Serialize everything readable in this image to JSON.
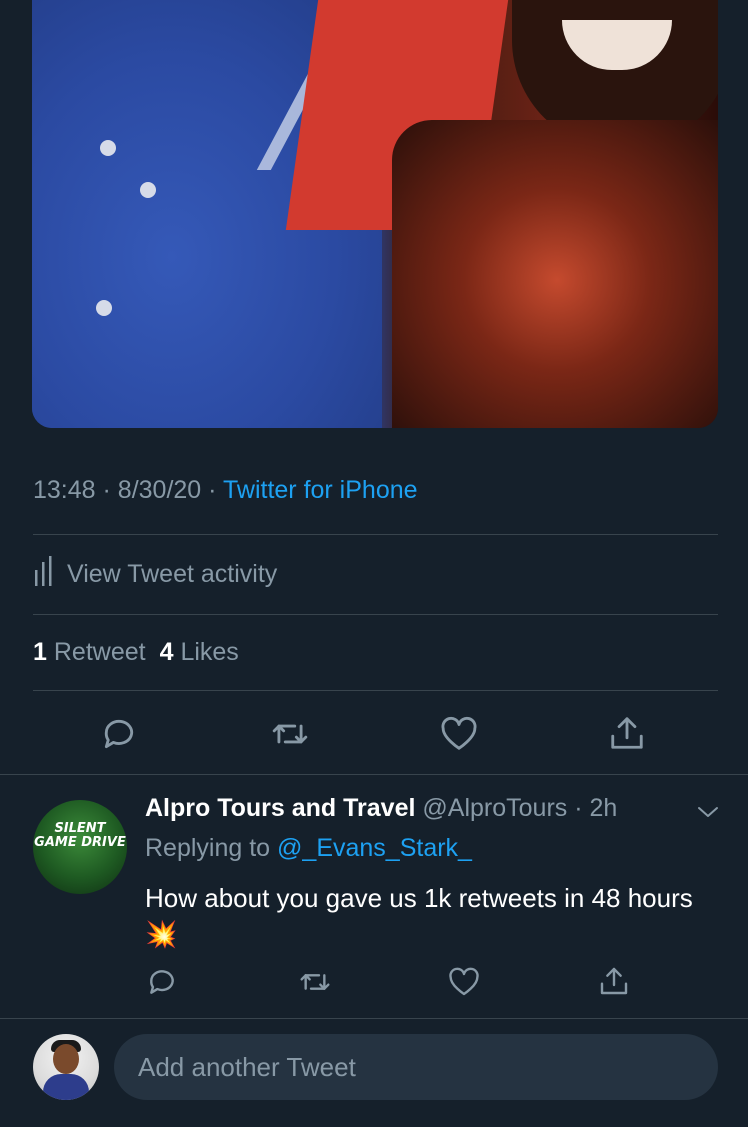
{
  "tweet": {
    "time": "13:48",
    "date": "8/30/20",
    "source": "Twitter for iPhone",
    "activity_label": "View Tweet activity",
    "retweet_count": "1",
    "retweet_label": "Retweet",
    "like_count": "4",
    "like_label": "Likes"
  },
  "reply": {
    "name": "Alpro Tours and Travel",
    "handle": "@AlproTours",
    "age": "2h",
    "replying_prefix": "Replying to",
    "replying_mention": "@_Evans_Stark_",
    "text": "How about you gave us 1k retweets in 48 hours",
    "emoji": "💥",
    "avatar_line1": "SILENT",
    "avatar_line2": "GAME DRIVE"
  },
  "compose": {
    "placeholder": "Add another Tweet"
  },
  "icons": {
    "reply": "reply-icon",
    "retweet": "retweet-icon",
    "like": "heart-icon",
    "share": "share-icon",
    "activity": "bar-chart-icon",
    "more": "chevron-down-icon"
  },
  "colors": {
    "background": "#15202b",
    "accent": "#1da1f2",
    "muted": "#8899a6",
    "divider": "#38444d"
  }
}
